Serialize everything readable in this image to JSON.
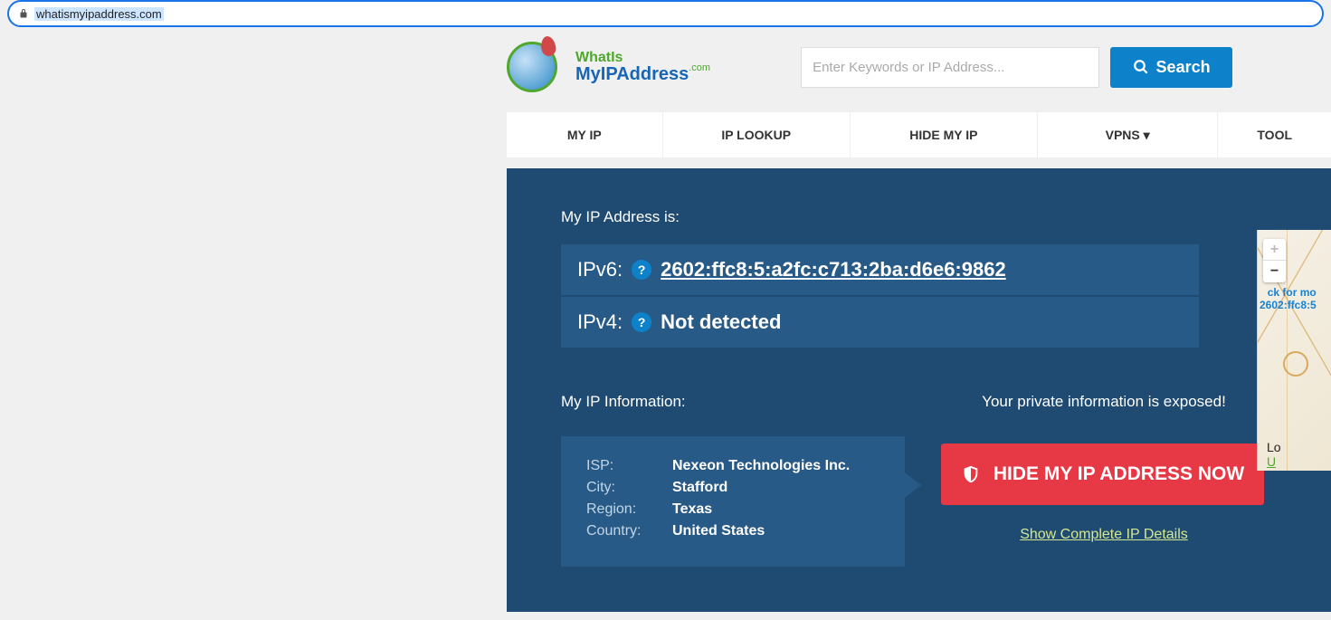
{
  "url": "whatismyipaddress.com",
  "logo": {
    "line1": "WhatIs",
    "line2": "MyIPAddress",
    "suffix": ".com"
  },
  "search": {
    "placeholder": "Enter Keywords or IP Address...",
    "button": "Search"
  },
  "nav": {
    "items": [
      "MY IP",
      "IP LOOKUP",
      "HIDE MY IP",
      "VPNS ▾",
      "TOOL"
    ]
  },
  "ip_section": {
    "title": "My IP Address is:",
    "ipv6_label": "IPv6:",
    "ipv6_value": "2602:ffc8:5:a2fc:c713:2ba:d6e6:9862",
    "ipv4_label": "IPv4:",
    "ipv4_value": "Not detected"
  },
  "info": {
    "title": "My IP Information:",
    "isp_label": "ISP:",
    "isp_value": "Nexeon Technologies Inc.",
    "city_label": "City:",
    "city_value": "Stafford",
    "region_label": "Region:",
    "region_value": "Texas",
    "country_label": "Country:",
    "country_value": "United States"
  },
  "warning": {
    "exposed_text": "Your private information is exposed!",
    "hide_button": "HIDE MY IP ADDRESS NOW",
    "show_link": "Show Complete IP Details"
  },
  "map": {
    "overlay_prefix": "ck for mo",
    "ip_overlay": "2602:ffc8:5",
    "loc_label": "Lo",
    "loc_link": "U"
  }
}
